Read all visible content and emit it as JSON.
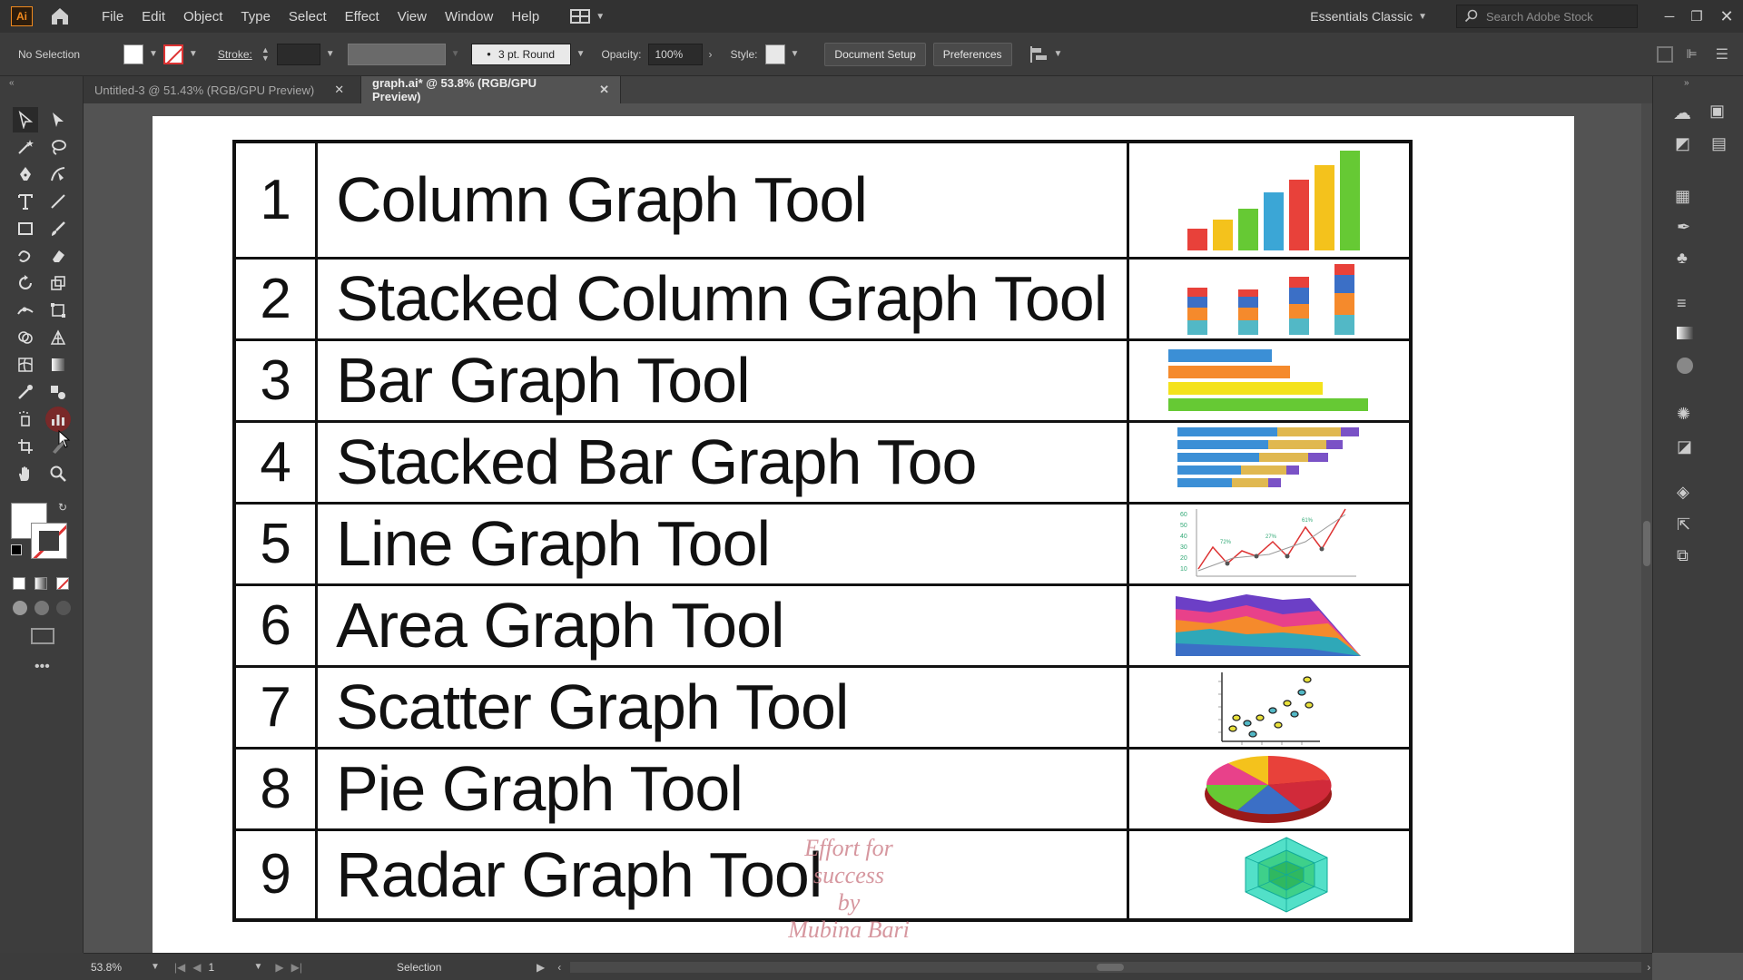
{
  "app": {
    "logo": "Ai",
    "menus": [
      "File",
      "Edit",
      "Object",
      "Type",
      "Select",
      "Effect",
      "View",
      "Window",
      "Help"
    ],
    "workspace": "Essentials Classic",
    "search_placeholder": "Search Adobe Stock"
  },
  "control_bar": {
    "selection_label": "No Selection",
    "stroke_label": "Stroke:",
    "brush_value": "3 pt. Round",
    "opacity_label": "Opacity:",
    "opacity_value": "100%",
    "style_label": "Style:",
    "document_setup": "Document Setup",
    "preferences": "Preferences"
  },
  "tabs": [
    {
      "label": "Untitled-3 @ 51.43% (RGB/GPU Preview)",
      "active": false
    },
    {
      "label": "graph.ai* @ 53.8% (RGB/GPU Preview)",
      "active": true
    }
  ],
  "status": {
    "zoom": "53.8%",
    "artboard": "1",
    "mode": "Selection"
  },
  "graph_tools": [
    {
      "num": "1",
      "name": "Column Graph Tool"
    },
    {
      "num": "2",
      "name": "Stacked Column Graph Tool"
    },
    {
      "num": "3",
      "name": "Bar Graph Tool"
    },
    {
      "num": "4",
      "name": "Stacked Bar Graph Too"
    },
    {
      "num": "5",
      "name": "Line Graph Tool"
    },
    {
      "num": "6",
      "name": "Area Graph Tool"
    },
    {
      "num": "7",
      "name": "Scatter Graph Tool"
    },
    {
      "num": "8",
      "name": "Pie Graph Tool"
    },
    {
      "num": "9",
      "name": "Radar Graph Tool"
    }
  ],
  "line_chart_labels": {
    "ticks": [
      "60",
      "50",
      "40",
      "30",
      "20",
      "10"
    ],
    "points": [
      "72%",
      "27%",
      "61%"
    ]
  },
  "watermark": {
    "line1": "Effort for success",
    "line2": "by",
    "line3": "Mubina Bari"
  },
  "colors": {
    "red": "#e8413a",
    "orange": "#f58a2c",
    "yellow": "#f4e21c",
    "green": "#66c934",
    "blue": "#3b8fd6",
    "teal": "#52b8c6"
  }
}
